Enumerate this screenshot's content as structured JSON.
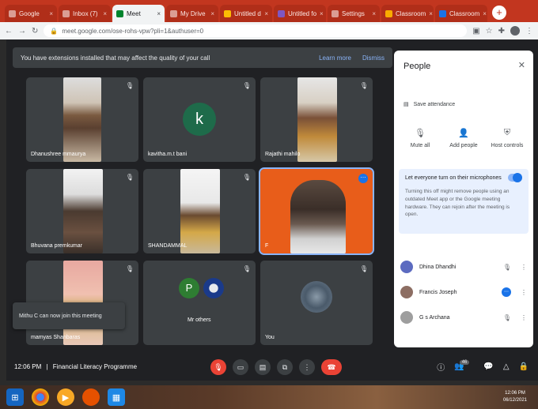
{
  "browser": {
    "tabs": [
      {
        "label": "Google",
        "active": false
      },
      {
        "label": "Inbox (7)",
        "active": false
      },
      {
        "label": "Meet",
        "active": true
      },
      {
        "label": "My Drive",
        "active": false
      },
      {
        "label": "Untitled d",
        "active": false
      },
      {
        "label": "Untitled fo",
        "active": false
      },
      {
        "label": "Settings",
        "active": false
      },
      {
        "label": "Classroom",
        "active": false
      },
      {
        "label": "Classroom",
        "active": false
      }
    ],
    "new_tab": "+",
    "url": "meet.google.com/ose-rohs-vpw?pli=1&authuser=0"
  },
  "banner": {
    "text": "You have extensions installed that may affect the quality of your call",
    "learn_more": "Learn more",
    "dismiss": "Dismiss"
  },
  "tiles": [
    {
      "name": "Dhanushree mmaurya"
    },
    {
      "name": "kavitha.m.t bani",
      "initial": "k"
    },
    {
      "name": "Rajathi mahilo"
    },
    {
      "name": "Bhuvana premkumar"
    },
    {
      "name": "SHANDAMMAL"
    },
    {
      "name": "Francis Joseph",
      "label": "F"
    },
    {
      "name": "mamyas Shanbaras"
    },
    {
      "name": "Mr others",
      "initial": "P"
    },
    {
      "name": "You"
    }
  ],
  "toast": {
    "text": "Mithu C can now join this meeting"
  },
  "people_panel": {
    "title": "People",
    "attendance": "Save attendance",
    "actions": [
      "Mute all",
      "Add people",
      "Host controls"
    ],
    "toggle_title": "Let everyone turn on their microphones",
    "toggle_desc": "Turning this off might remove people using an outdated Meet app or the Google meeting hardware. They can rejoin after the meeting is open.",
    "participants": [
      {
        "name": "Dhina Dhandhi",
        "color": "#5c6bc0"
      },
      {
        "name": "Francis Joseph",
        "color": "#8d6e63"
      },
      {
        "name": "G s Archana",
        "color": "#9e9e9e"
      }
    ]
  },
  "bottom": {
    "time": "12:06 PM",
    "separator": "|",
    "meeting_name": "Financial Literacy Programme",
    "people_count": "46"
  },
  "taskbar": {
    "time": "12:06 PM",
    "date": "06/12/2021"
  },
  "colors": {
    "meet_bg": "#202124",
    "tile_bg": "#3c4043",
    "accent": "#1a73e8",
    "end_call": "#ea4335",
    "browser_frame": "#c2361f"
  }
}
